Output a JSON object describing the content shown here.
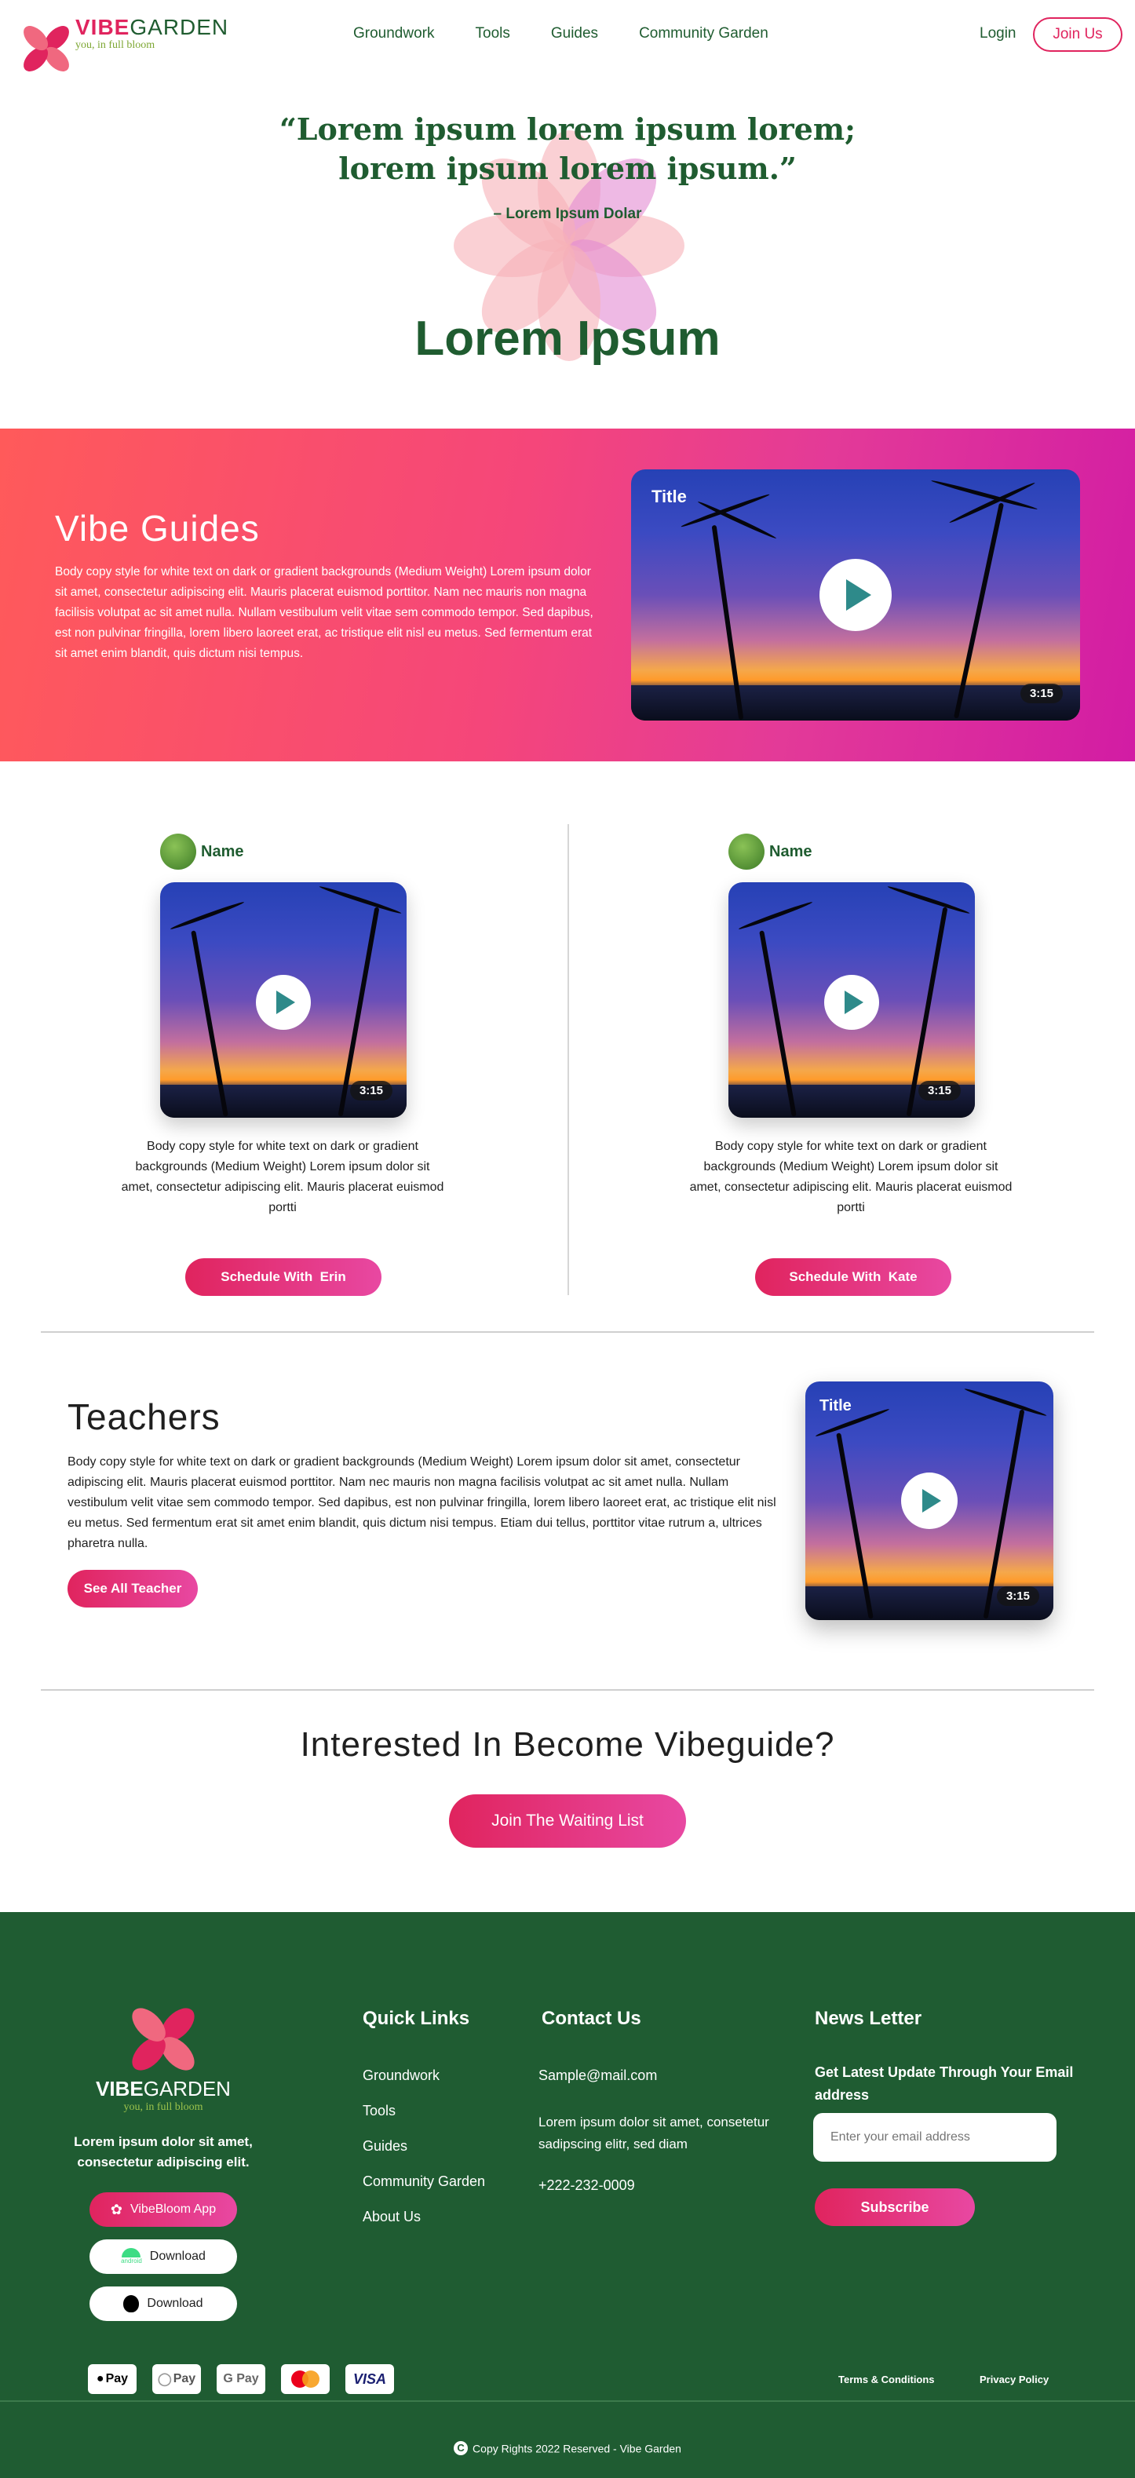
{
  "nav": {
    "brand_bold": "VIBE",
    "brand_rest": "GARDEN",
    "tagline": "you, in full bloom",
    "links": [
      "Groundwork",
      "Tools",
      "Guides",
      "Community Garden"
    ],
    "login": "Login",
    "join": "Join Us"
  },
  "hero": {
    "quote_line1": "“Lorem ipsum lorem ipsum lorem;",
    "quote_line2": "lorem ipsum lorem ipsum.”",
    "author": "– Lorem Ipsum Dolar",
    "title": "Lorem Ipsum"
  },
  "banner": {
    "title": "Vibe Guides",
    "body": "Body copy style for white text on dark or gradient backgrounds (Medium Weight) Lorem ipsum dolor sit amet, consectetur adipiscing elit. Mauris placerat euismod porttitor. Nam nec mauris non magna facilisis volutpat ac sit amet nulla. Nullam vestibulum velit vitae sem commodo tempor. Sed dapibus, est non pulvinar fringilla, lorem libero laoreet erat, ac tristique elit nisl eu metus. Sed fermentum erat sit amet enim blandit, quis dictum nisi tempus.",
    "video_title": "Title",
    "video_duration": "3:15"
  },
  "guides": [
    {
      "name": "Name",
      "duration": "3:15",
      "body": "Body copy style for white text on dark or gradient backgrounds (Medium Weight) Lorem ipsum dolor sit amet, consectetur adipiscing elit. Mauris placerat euismod portti",
      "button": "Schedule With  Erin"
    },
    {
      "name": "Name",
      "duration": "3:15",
      "body": "Body copy style for white text on dark or gradient backgrounds (Medium Weight) Lorem ipsum dolor sit amet, consectetur adipiscing elit. Mauris placerat euismod portti",
      "button": "Schedule With  Kate"
    }
  ],
  "teachers": {
    "title": "Teachers",
    "body": "Body copy style for white text on dark or gradient backgrounds (Medium Weight) Lorem ipsum dolor sit amet, consectetur adipiscing elit. Mauris placerat euismod porttitor. Nam nec mauris non magna facilisis volutpat ac sit amet nulla. Nullam vestibulum velit vitae sem commodo tempor. Sed dapibus, est non pulvinar fringilla, lorem libero laoreet erat, ac tristique elit nisl eu metus. Sed fermentum erat sit amet enim blandit, quis dictum nisi tempus. Etiam dui tellus, porttitor vitae rutrum a, ultrices pharetra nulla.",
    "button": "See All Teacher",
    "video_title": "Title",
    "video_duration": "3:15"
  },
  "cta": {
    "title": "Interested In Become Vibeguide?",
    "button": "Join The Waiting List"
  },
  "footer": {
    "brand_bold": "VIBE",
    "brand_rest": "GARDEN",
    "tagline": "you, in full bloom",
    "description": "Lorem ipsum dolor sit amet, consectetur adipiscing elit.",
    "app_button": "VibeBloom App",
    "android_button": "Download",
    "android_label": "android",
    "ios_button": "Download",
    "quick_links_title": "Quick Links",
    "quick_links": [
      "Groundwork",
      "Tools",
      "Guides",
      "Community Garden",
      "About Us"
    ],
    "contact_title": "Contact Us",
    "contact_email": "Sample@mail.com",
    "contact_address": "Lorem ipsum dolor sit amet, consetetur sadipscing elitr, sed diam",
    "contact_phone": "+222-232-0009",
    "newsletter_title": "News Letter",
    "newsletter_text": "Get Latest Update Through Your Email address",
    "email_placeholder": "Enter your email address",
    "subscribe": "Subscribe",
    "payments": [
      "Pay",
      "Pay",
      "G Pay",
      "VISA"
    ],
    "terms": "Terms & Conditions",
    "privacy": "Privacy Policy",
    "copyright": "Copy Rights 2022 Reserved - Vibe Garden"
  },
  "colors": {
    "brand_green": "#1f5c30",
    "brand_pink": "#e0245e",
    "footer_bg": "#1f5c32"
  }
}
